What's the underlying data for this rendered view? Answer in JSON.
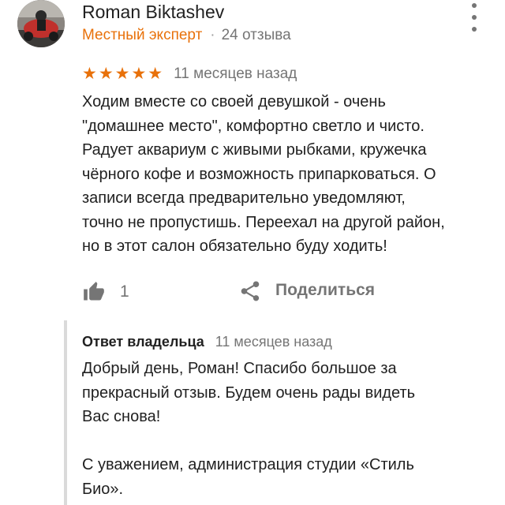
{
  "review": {
    "author_name": "Roman Biktashev",
    "badge": "Местный эксперт",
    "separator": "·",
    "reviews_count": "24 отзыва",
    "rating": 5,
    "stars": "★★★★★",
    "time_ago": "11 месяцев назад",
    "text_lines": [
      "Ходим вместе со своей девушкой - очень",
      "\"домашнее место\", комфортно светло и чисто.",
      "Радует аквариум с живыми рыбками, кружечка",
      "чёрного кофе и возможность припарковаться. О",
      "записи всегда предварительно уведомляют,",
      "точно не пропустишь. Переехал на другой район,",
      "но в этот салон обязательно буду ходить!"
    ],
    "likes": "1",
    "share_label": "Поделиться"
  },
  "owner_reply": {
    "label": "Ответ владельца",
    "time_ago": "11 месяцев назад",
    "text_lines": [
      "Добрый день, Роман! Спасибо большое за",
      "прекрасный отзыв. Будем очень рады видеть",
      "Вас снова!",
      "",
      "С уважением, администрация студии «Стиль",
      "Био»."
    ]
  },
  "icons": {
    "more": "more-vertical-icon",
    "like": "thumbs-up-icon",
    "share": "share-icon"
  },
  "colors": {
    "accent": "#e8710a",
    "secondary_text": "#757575",
    "reply_bar": "#dadada"
  }
}
